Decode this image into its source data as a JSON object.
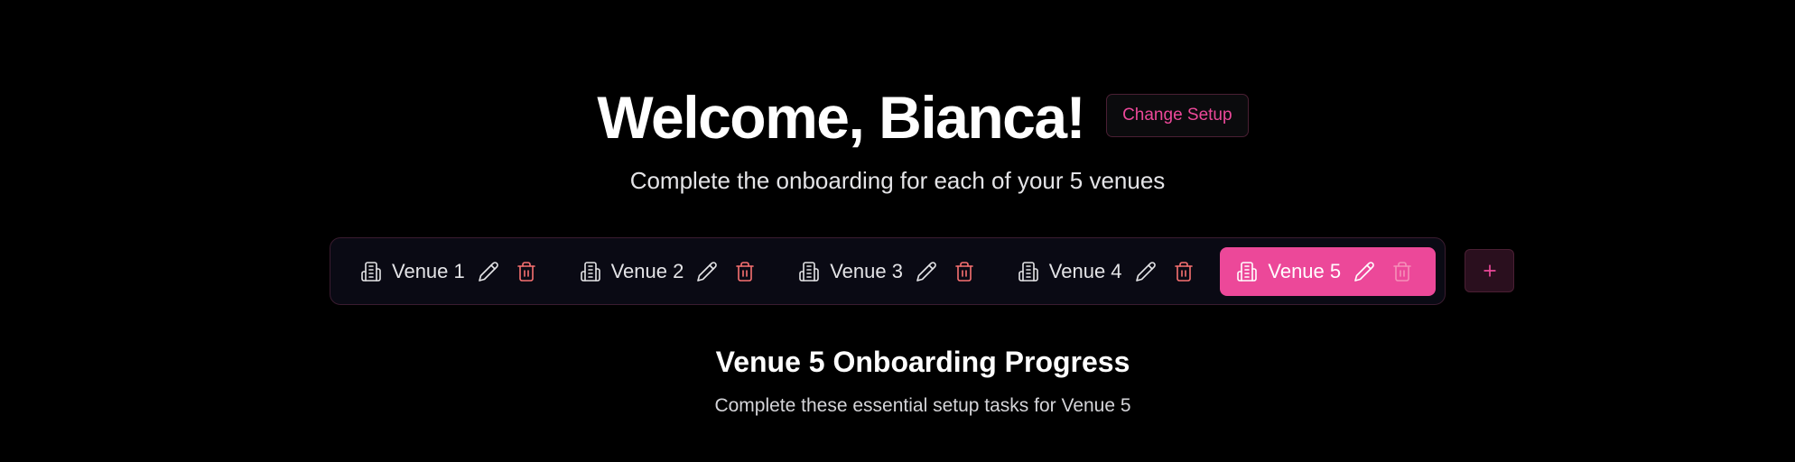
{
  "header": {
    "welcome_title": "Welcome, Bianca!",
    "change_setup_label": "Change Setup",
    "subtitle": "Complete the onboarding for each of your 5 venues"
  },
  "venues": [
    {
      "label": "Venue 1",
      "active": false
    },
    {
      "label": "Venue 2",
      "active": false
    },
    {
      "label": "Venue 3",
      "active": false
    },
    {
      "label": "Venue 4",
      "active": false
    },
    {
      "label": "Venue 5",
      "active": true
    }
  ],
  "icons": {
    "venue": "building-icon",
    "edit": "pencil-icon",
    "delete": "trash-icon",
    "add": "plus-icon"
  },
  "progress": {
    "title": "Venue 5 Onboarding Progress",
    "subtitle": "Complete these essential setup tasks for Venue 5"
  },
  "colors": {
    "accent": "#ec4899",
    "delete": "#f87171",
    "background": "#000000"
  }
}
